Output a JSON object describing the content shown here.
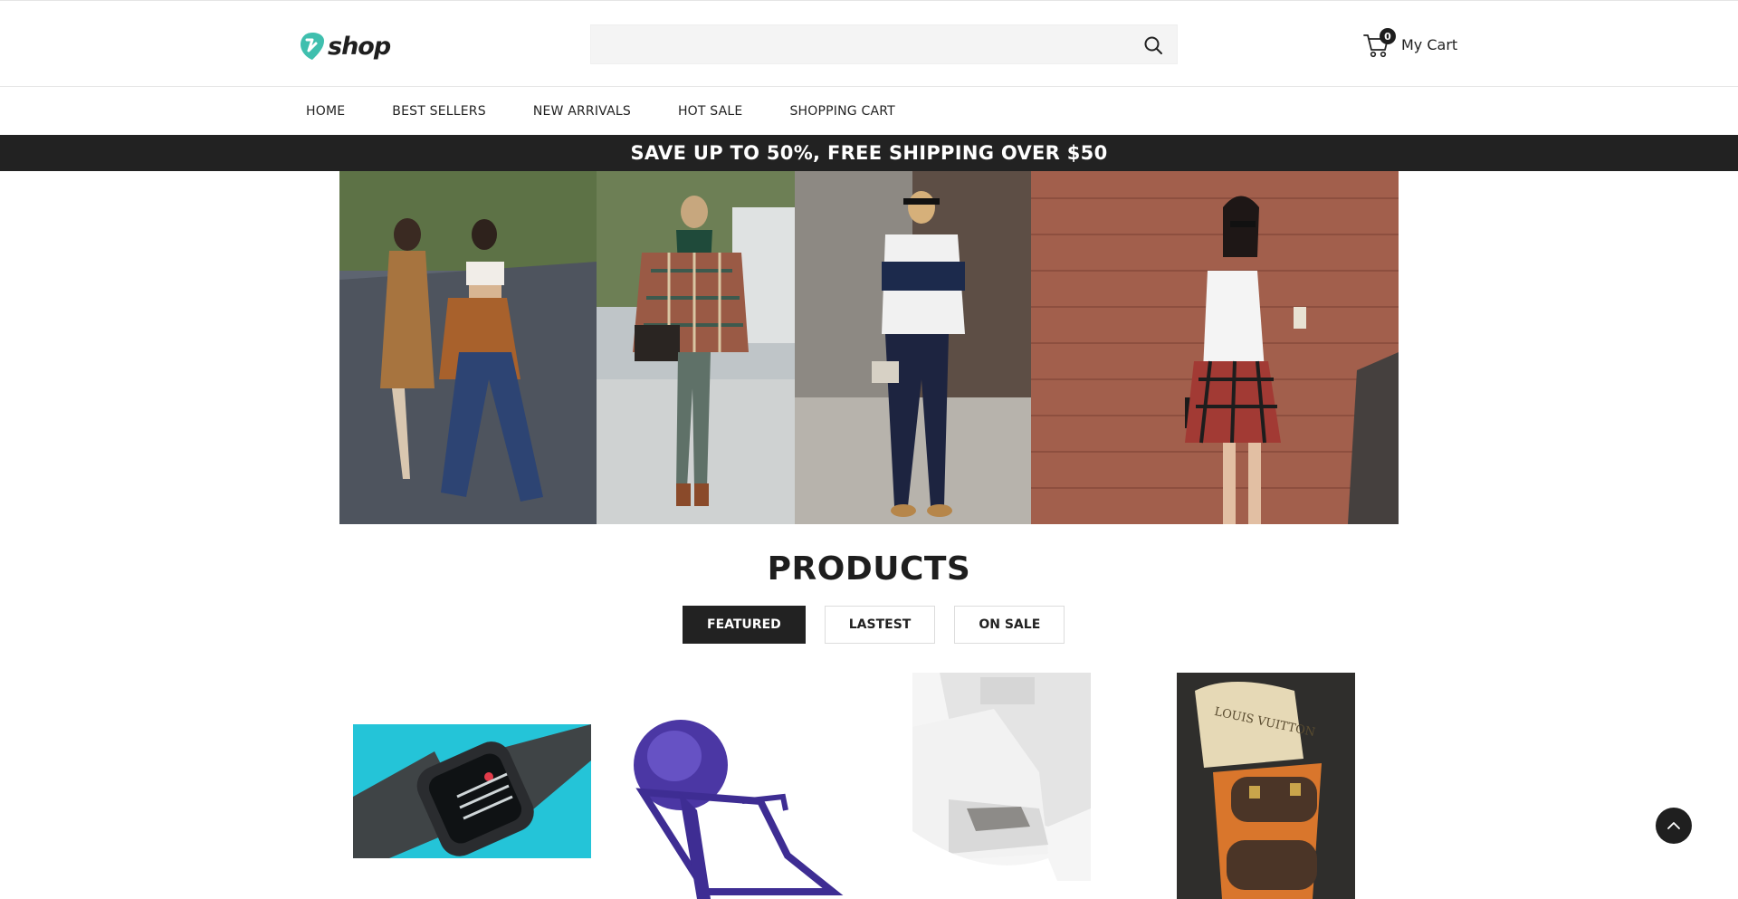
{
  "header": {
    "logo_text": "shop",
    "search": {
      "value": "",
      "placeholder": ""
    },
    "cart": {
      "count": "0",
      "label": "My Cart"
    }
  },
  "nav": {
    "items": [
      {
        "label": "HOME"
      },
      {
        "label": "BEST SELLERS"
      },
      {
        "label": "NEW ARRIVALS"
      },
      {
        "label": "HOT SALE"
      },
      {
        "label": "SHOPPING CART"
      }
    ]
  },
  "promo": {
    "text": "SAVE UP TO 50%, FREE SHIPPING OVER $50"
  },
  "products": {
    "title": "PRODUCTS",
    "tabs": [
      {
        "label": "FEATURED",
        "active": true
      },
      {
        "label": "LASTEST",
        "active": false
      },
      {
        "label": "ON SALE",
        "active": false
      }
    ]
  },
  "colors": {
    "accent": "#3fbfae",
    "dark": "#222222",
    "promo_bg": "#222222"
  },
  "icons": {
    "logo": "leaf-logo-icon",
    "search": "search-icon",
    "cart": "cart-icon",
    "scroll_top": "chevron-up-icon"
  }
}
